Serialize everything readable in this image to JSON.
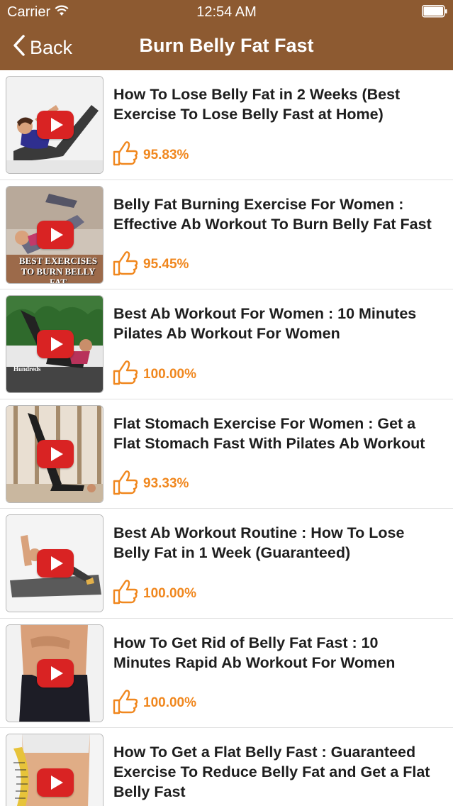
{
  "status": {
    "carrier": "Carrier",
    "time": "12:54 AM"
  },
  "nav": {
    "back_label": "Back",
    "title": "Burn Belly Fat Fast"
  },
  "colors": {
    "nav_bar": "#8d5a31",
    "rating": "#f0871e",
    "play_button": "#d92323"
  },
  "videos": [
    {
      "title": "How To Lose Belly Fat in 2 Weeks (Best Exercise To Lose Belly Fast at Home)",
      "rating": "95.83%",
      "thumb_caption": ""
    },
    {
      "title": "Belly Fat Burning Exercise For Women : Effective Ab Workout To Burn Belly Fat Fast",
      "rating": "95.45%",
      "thumb_caption": "BEST EXERCISES TO BURN BELLY FAT"
    },
    {
      "title": "Best Ab Workout For Women : 10 Minutes Pilates Ab Workout For Women",
      "rating": "100.00%",
      "thumb_caption": "Hundreds"
    },
    {
      "title": "Flat Stomach Exercise For Women : Get a Flat Stomach Fast With Pilates Ab Workout",
      "rating": "93.33%",
      "thumb_caption": ""
    },
    {
      "title": "Best Ab Workout Routine : How To Lose Belly Fat in 1 Week (Guaranteed)",
      "rating": "100.00%",
      "thumb_caption": ""
    },
    {
      "title": "How To Get Rid of Belly Fat Fast : 10 Minutes Rapid Ab Workout For Women",
      "rating": "100.00%",
      "thumb_caption": ""
    },
    {
      "title": "How To Get a Flat Belly Fast : Guaranteed Exercise To Reduce Belly Fat and Get a Flat Belly Fast",
      "rating": "",
      "thumb_caption": ""
    }
  ]
}
